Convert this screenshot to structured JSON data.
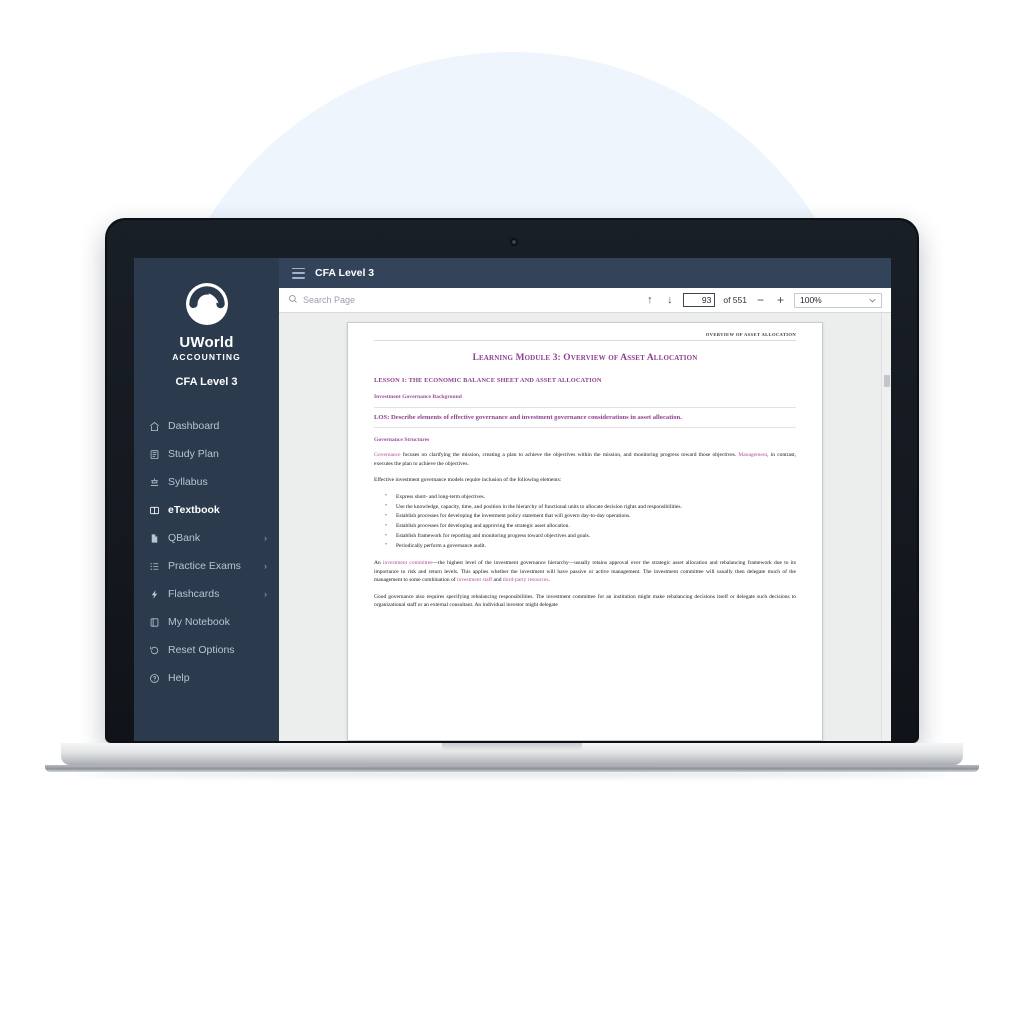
{
  "sidebar": {
    "brand_name": "UWorld",
    "brand_sub": "ACCOUNTING",
    "course": "CFA Level 3",
    "items": [
      {
        "label": "Dashboard",
        "icon": "home-icon",
        "active": false,
        "chevron": ""
      },
      {
        "label": "Study Plan",
        "icon": "calendar-icon",
        "active": false,
        "chevron": ""
      },
      {
        "label": "Syllabus",
        "icon": "syllabus-icon",
        "active": false,
        "chevron": ""
      },
      {
        "label": "eTextbook",
        "icon": "book-icon",
        "active": true,
        "chevron": ""
      },
      {
        "label": "QBank",
        "icon": "file-icon",
        "active": false,
        "chevron": "›"
      },
      {
        "label": "Practice Exams",
        "icon": "list-icon",
        "active": false,
        "chevron": "›"
      },
      {
        "label": "Flashcards",
        "icon": "bolt-icon",
        "active": false,
        "chevron": "›"
      },
      {
        "label": "My Notebook",
        "icon": "notebook-icon",
        "active": false,
        "chevron": ""
      },
      {
        "label": "Reset Options",
        "icon": "reset-icon",
        "active": false,
        "chevron": ""
      },
      {
        "label": "Help",
        "icon": "help-icon",
        "active": false,
        "chevron": ""
      }
    ]
  },
  "titlebar": {
    "menu_icon": "hamburger-icon",
    "title": "CFA Level 3"
  },
  "toolbar": {
    "search_placeholder": "Search Page",
    "search_value": "",
    "search_icon": "search-icon",
    "prev_icon": "↑",
    "next_icon": "↓",
    "page_current": "93",
    "page_total": "of 551",
    "zoom_out": "−",
    "zoom_in": "+",
    "zoom_level": "100%",
    "zoom_chevron": "⌄"
  },
  "document": {
    "running_header": "OVERVIEW OF ASSET ALLOCATION",
    "module_title": "Learning Module 3: Overview of Asset Allocation",
    "lesson_heading": "LESSON 1: THE ECONOMIC BALANCE SHEET AND ASSET ALLOCATION",
    "subheading": "Investment Governance Background",
    "los": "LOS: Describe elements of effective governance and investment governance considerations in asset allocation.",
    "governance_structures": "Governance Structures",
    "para1_a": "Governance",
    "para1_b": " focuses on clarifying the mission, creating a plan to achieve the objectives within the mission, and monitoring progress toward those objectives. ",
    "para1_c": "Management",
    "para1_d": ", in contrast, executes the plan to achieve the objectives.",
    "para2": "Effective investment governance models require inclusion of the following elements:",
    "bullets": [
      "Express short- and long-term objectives.",
      "Use the knowledge, capacity, time, and position in the hierarchy of functional units to allocate decision rights and responsibilities.",
      "Establish processes for developing the investment policy statement that will govern day-to-day operations.",
      "Establish processes for developing and approving the strategic asset allocation.",
      "Establish framework for reporting and monitoring progress toward objectives and goals.",
      "Periodically perform a governance audit."
    ],
    "para3_a": "An ",
    "para3_b": "investment committee",
    "para3_c": "—the highest level of the investment governance hierarchy—usually retains approval over the strategic asset allocation and rebalancing framework due to its importance to risk and return levels. This applies whether the investment will have passive or active management. The investment committee will usually then delegate much of the management to some combination of ",
    "para3_d": "investment staff",
    "para3_e": " and ",
    "para3_f": "third-party resources",
    "para3_g": ".",
    "para4": "Good governance also requires specifying rebalancing responsibilities. The investment committee for an institution might make rebalancing decisions itself or delegate such decisions to organizational staff or an external consultant. An individual investor might delegate"
  },
  "colors": {
    "sidebar_bg": "#2b3a4d",
    "titlebar_bg": "#33435a",
    "accent_purple": "#8e3f8e",
    "highlight_purple": "#b0519f",
    "backdrop_circle": "#eff5fd",
    "viewer_bg": "#eceded"
  }
}
